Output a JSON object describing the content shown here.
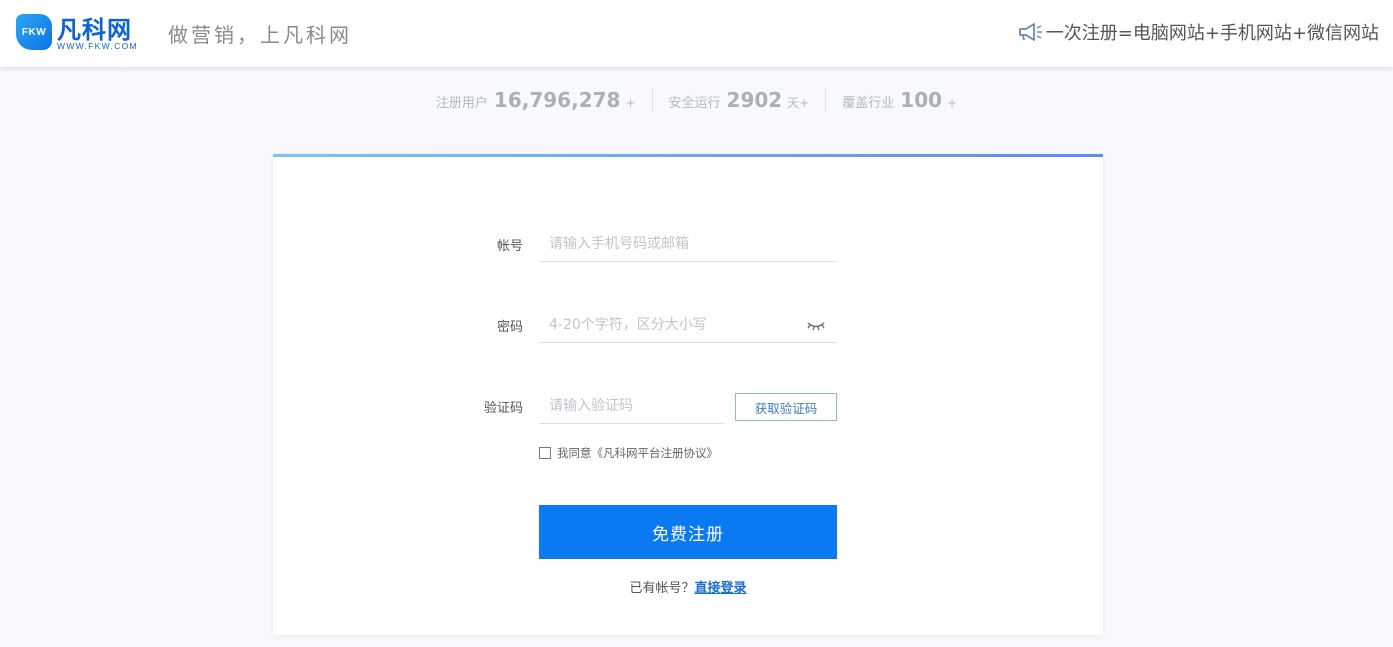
{
  "header": {
    "logo_badge": "FKW",
    "logo_name": "凡科网",
    "logo_url": "WWW.FKW.COM",
    "slogan": "做营销，上凡科网",
    "promo_icon": "megaphone-icon",
    "promo_text": "一次注册=电脑网站+手机网站+微信网站"
  },
  "stats": [
    {
      "label": "注册用户",
      "value": "16,796,278",
      "suffix": "+"
    },
    {
      "label": "安全运行",
      "value": "2902",
      "suffix": "天+"
    },
    {
      "label": "覆盖行业",
      "value": "100",
      "suffix": "+"
    }
  ],
  "form": {
    "account_label": "帐号",
    "account_placeholder": "请输入手机号码或邮箱",
    "password_label": "密码",
    "password_placeholder": "4-20个字符，区分大小写",
    "password_toggle_icon": "eye-closed-icon",
    "code_label": "验证码",
    "code_placeholder": "请输入验证码",
    "get_code_button": "获取验证码",
    "agree_text": "我同意《凡科网平台注册协议》",
    "agree_checked": false,
    "submit_button": "免费注册",
    "have_account_text": "已有帐号？",
    "login_link": "直接登录"
  },
  "colors": {
    "accent": "#0a7af3",
    "brand": "#0e62d8",
    "link": "#1c6fd1"
  }
}
